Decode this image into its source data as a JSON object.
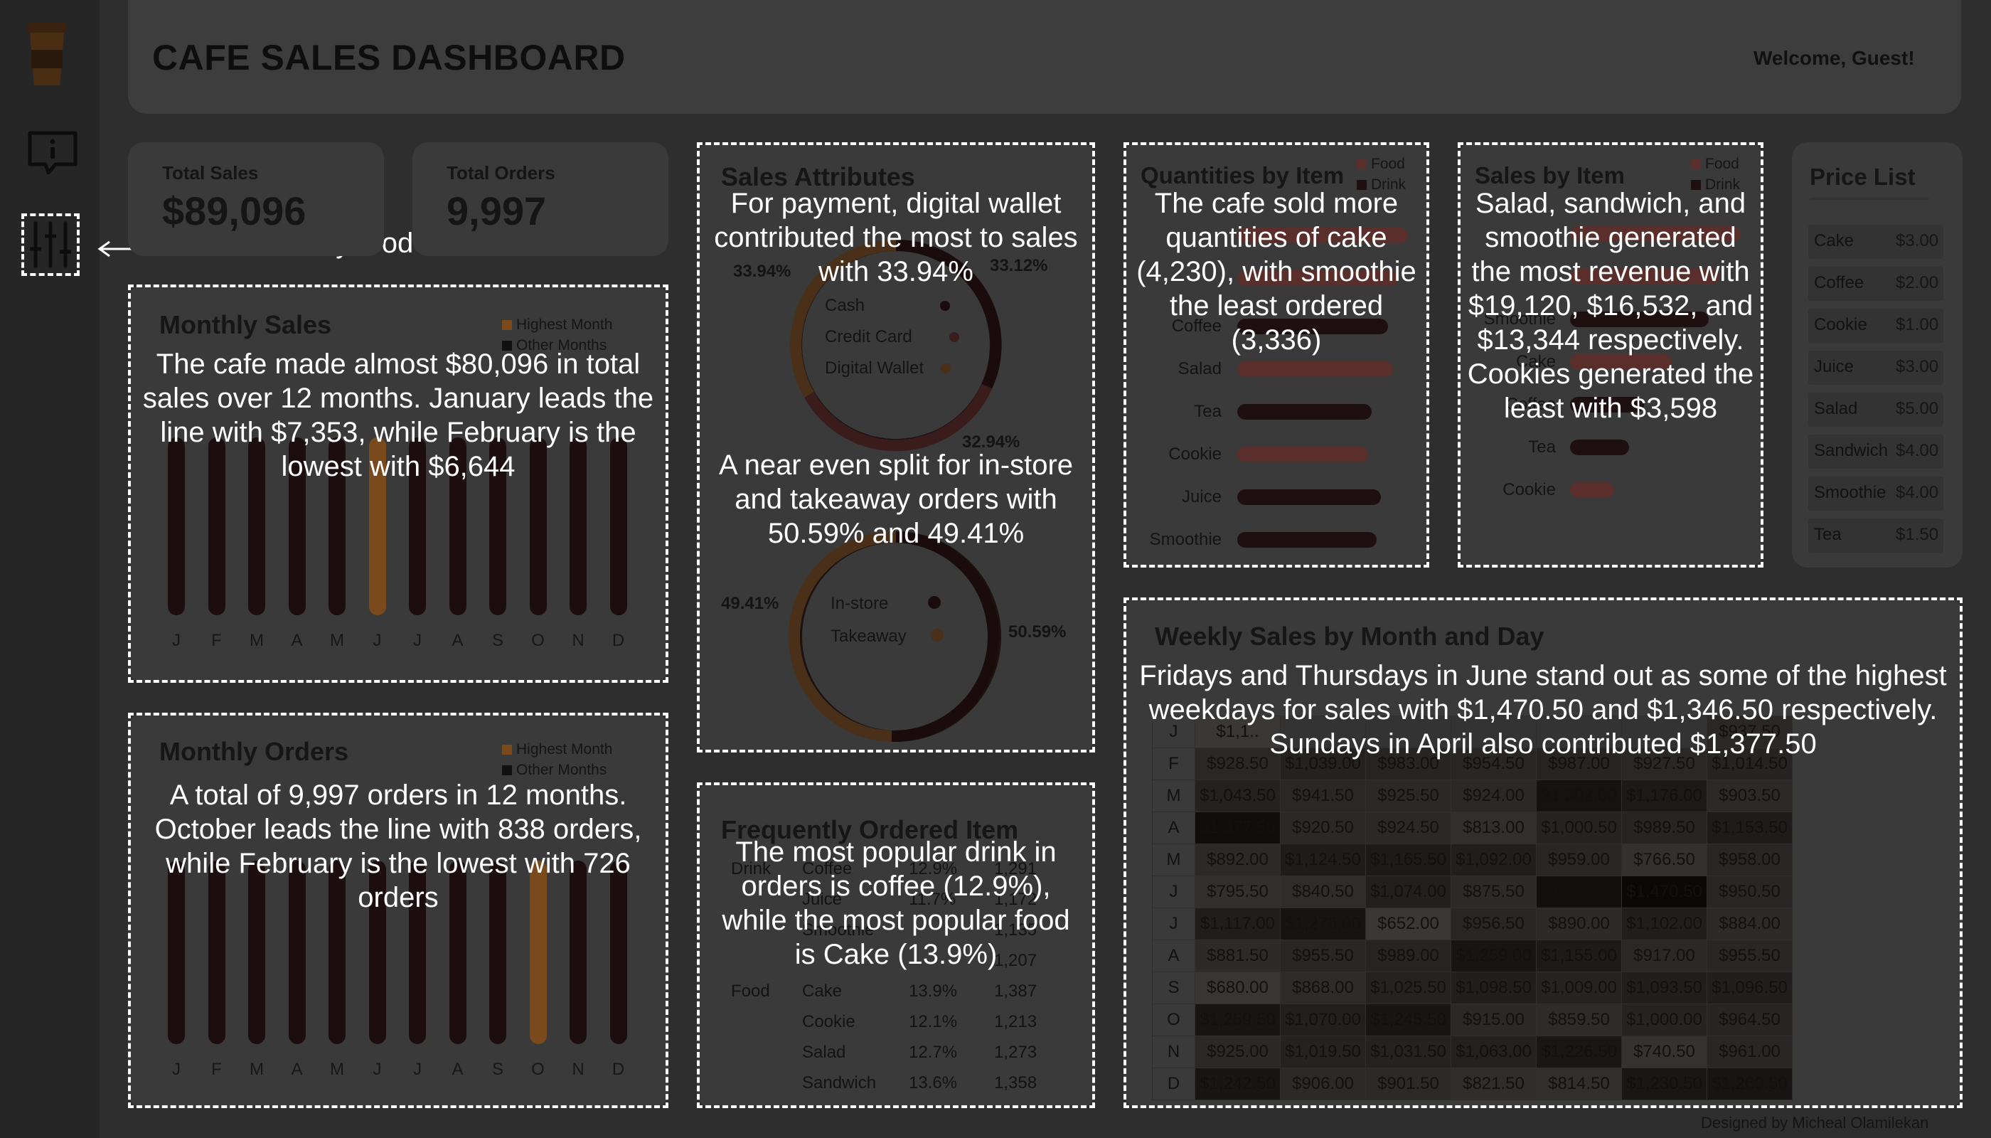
{
  "header": {
    "title": "CAFE SALES DASHBOARD",
    "welcome": "Welcome, Guest!"
  },
  "sidebar": {
    "icons": [
      "coffee-cup-logo",
      "info-icon",
      "filter-icon"
    ]
  },
  "kpis": [
    {
      "label": "Total Sales",
      "value": "$89,096"
    },
    {
      "label": "Total Orders",
      "value": "9,997"
    }
  ],
  "filter_note": "Filter by food or drink",
  "monthly_sales": {
    "title": "Monthly Sales",
    "legend": [
      "Highest Month",
      "Other Months"
    ],
    "months": [
      "J",
      "F",
      "M",
      "A",
      "M",
      "J",
      "J",
      "A",
      "S",
      "O",
      "N",
      "D"
    ],
    "note": "The cafe made almost $80,096 in total sales over 12 months. January leads the line with $7,353, while February is the lowest with $6,644"
  },
  "monthly_orders": {
    "title": "Monthly Orders",
    "legend": [
      "Highest Month",
      "Other Months"
    ],
    "months": [
      "J",
      "F",
      "M",
      "A",
      "M",
      "J",
      "J",
      "A",
      "S",
      "O",
      "N",
      "D"
    ],
    "note": "A total of 9,997 orders in 12 months. October leads the line with 838 orders, while February is the lowest with 726 orders"
  },
  "sales_attributes": {
    "title": "Sales Attributes",
    "payment": {
      "labels": [
        "Cash",
        "Credit Card",
        "Digital Wallet"
      ],
      "pcts": [
        "33.94%",
        "33.12%",
        "32.94%"
      ]
    },
    "order_type": {
      "labels": [
        "In-store",
        "Takeaway"
      ],
      "pcts": [
        "49.41%",
        "50.59%"
      ]
    },
    "note_payment": "For payment, digital wallet contributed the most to sales with 33.94%",
    "note_order": "A near even split for in-store and takeaway orders with 50.59% and 49.41%"
  },
  "frequently_ordered": {
    "title": "Frequently Ordered Item",
    "groups": {
      "drink": "Drink",
      "food": "Food"
    },
    "drink_rows": [
      {
        "item": "Coffee",
        "pct": "12.9%",
        "count": "1,291"
      },
      {
        "item": "Juice",
        "pct": "11.7%",
        "count": "1,172"
      },
      {
        "item": "Smoothie",
        "pct": "",
        "count": "1,135"
      },
      {
        "item": "",
        "pct": "",
        "count": "1,207"
      }
    ],
    "food_rows": [
      {
        "item": "Cake",
        "pct": "13.9%",
        "count": "1,387"
      },
      {
        "item": "Cookie",
        "pct": "12.1%",
        "count": "1,213"
      },
      {
        "item": "Salad",
        "pct": "12.7%",
        "count": "1,273"
      },
      {
        "item": "Sandwich",
        "pct": "13.6%",
        "count": "1,358"
      }
    ],
    "note": "The most popular drink in orders is coffee (12.9%), while the most popular food is Cake (13.9%)"
  },
  "quantities_by_item": {
    "title": "Quantities by Item",
    "legend": [
      "Food",
      "Drink"
    ],
    "items": [
      "Coffee",
      "Salad",
      "Tea",
      "Cookie",
      "Juice",
      "Smoothie"
    ],
    "note": "The cafe sold more quantities of cake (4,230), with smoothie the least ordered (3,336)"
  },
  "sales_by_item": {
    "title": "Sales by Item",
    "legend": [
      "Food",
      "Drink"
    ],
    "items": [
      "Smoothie",
      "Cake",
      "Coffee",
      "Tea",
      "Cookie"
    ],
    "note": "Salad, sandwich, and smoothie generated the most revenue with $19,120, $16,532, and $13,344 respectively. Cookies generated the least with $3,598"
  },
  "price_list": {
    "title": "Price List",
    "items": [
      [
        "Cake",
        "$3.00"
      ],
      [
        "Coffee",
        "$2.00"
      ],
      [
        "Cookie",
        "$1.00"
      ],
      [
        "Juice",
        "$3.00"
      ],
      [
        "Salad",
        "$5.00"
      ],
      [
        "Sandwich",
        "$4.00"
      ],
      [
        "Smoothie",
        "$4.00"
      ],
      [
        "Tea",
        "$1.50"
      ]
    ]
  },
  "weekly_sales": {
    "title": "Weekly Sales by Month and Day",
    "note": "Fridays and Thursdays in June stand out as some of the highest weekdays for sales with $1,470.50 and $1,346.50 respectively. Sundays in April also contributed $1,377.50",
    "rows": [
      {
        "m": "J",
        "v": [
          "$1,1..",
          "",
          "",
          "",
          "",
          "",
          "$937.50"
        ]
      },
      {
        "m": "F",
        "v": [
          "$928.50",
          "$1,039.00",
          "$983.00",
          "$954.50",
          "$987.00",
          "$927.50",
          "$1,014.50"
        ]
      },
      {
        "m": "M",
        "v": [
          "$1,043.50",
          "$941.50",
          "$925.50",
          "$924.00",
          "$1,302.00",
          "$1,176.00",
          "$903.50"
        ]
      },
      {
        "m": "A",
        "v": [
          "$1,377.50",
          "$920.50",
          "$924.50",
          "$813.00",
          "$1,000.50",
          "$989.50",
          "$1,153.50"
        ]
      },
      {
        "m": "M",
        "v": [
          "$892.00",
          "$1,124.50",
          "$1,165.50",
          "$1,092.00",
          "$959.00",
          "$766.50",
          "$958.00"
        ]
      },
      {
        "m": "J",
        "v": [
          "$795.50",
          "$840.50",
          "$1,074.00",
          "$875.50",
          "$1,346.50",
          "$1,470.50",
          "$950.50"
        ]
      },
      {
        "m": "J",
        "v": [
          "$1,117.00",
          "$1,276.00",
          "$652.00",
          "$956.50",
          "$890.00",
          "$1,102.00",
          "$884.00"
        ]
      },
      {
        "m": "A",
        "v": [
          "$881.50",
          "$955.50",
          "$989.00",
          "$1,259.00",
          "$1,155.00",
          "$917.00",
          "$955.50"
        ]
      },
      {
        "m": "S",
        "v": [
          "$680.00",
          "$868.00",
          "$1,025.50",
          "$1,098.50",
          "$1,009.00",
          "$1,093.50",
          "$1,096.50"
        ]
      },
      {
        "m": "O",
        "v": [
          "$1,259.50",
          "$1,070.00",
          "$1,245.50",
          "$915.00",
          "$859.50",
          "$1,000.00",
          "$964.50"
        ]
      },
      {
        "m": "N",
        "v": [
          "$925.00",
          "$1,019.50",
          "$1,031.50",
          "$1,063.00",
          "$1,226.50",
          "$740.50",
          "$961.00"
        ]
      },
      {
        "m": "D",
        "v": [
          "$1,242.50",
          "$906.00",
          "$901.50",
          "$821.50",
          "$814.50",
          "$1,230.50",
          "$1,260.50"
        ]
      }
    ]
  },
  "footer": "Designed by Micheal Olamilekan",
  "colors": {
    "highest": "#7a4a1c",
    "other": "#1c0e0e",
    "food": "#5a2e2a",
    "drink": "#1e1010"
  }
}
